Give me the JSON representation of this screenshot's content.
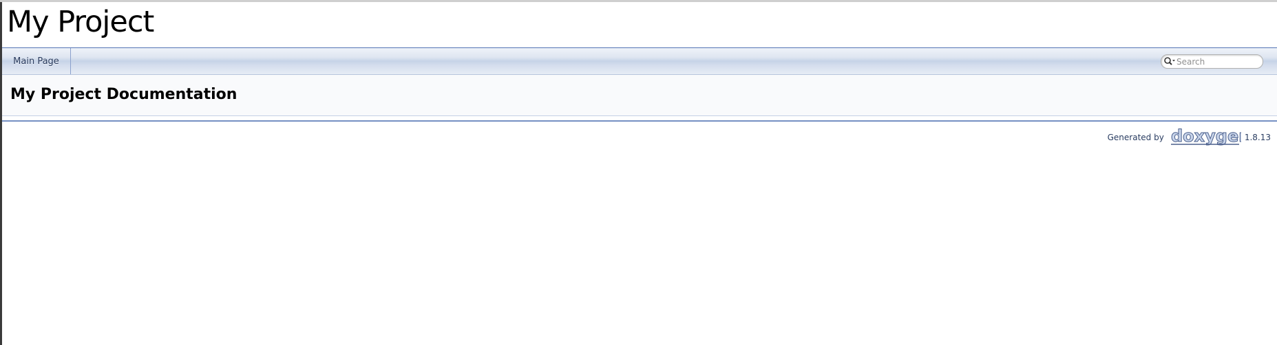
{
  "project": {
    "name": "My Project"
  },
  "navbar": {
    "items": [
      {
        "label": "Main Page"
      }
    ],
    "search": {
      "placeholder": "Search",
      "icon": "search-icon"
    }
  },
  "header": {
    "title": "My Project Documentation"
  },
  "footer": {
    "generated_by": "Generated by",
    "logo_text": "doxygen",
    "version": "1.8.13"
  },
  "colors": {
    "accent": "#5373b4",
    "nav_text": "#283a5d",
    "footer_text": "#2a3d61"
  }
}
